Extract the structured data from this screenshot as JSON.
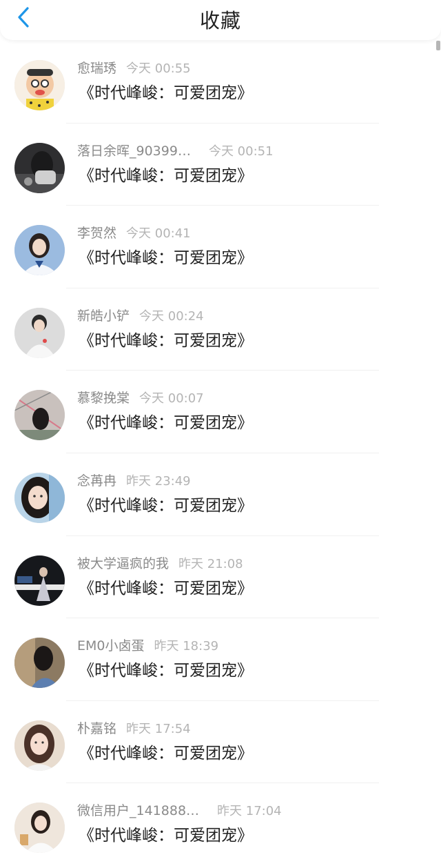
{
  "header": {
    "title": "收藏",
    "back_icon": "chevron-left-icon",
    "accent": "#1e96e8"
  },
  "items": [
    {
      "name": "愈瑞琇",
      "time": "今天 00:55",
      "content": "《时代峰峻：可爱团宠》"
    },
    {
      "name": "落日余晖_90399…",
      "time": "今天 00:51",
      "content": "《时代峰峻：可爱团宠》"
    },
    {
      "name": "李贺然",
      "time": "今天 00:41",
      "content": "《时代峰峻：可爱团宠》"
    },
    {
      "name": "新皓小铲",
      "time": "今天 00:24",
      "content": "《时代峰峻：可爱团宠》"
    },
    {
      "name": "慕黎挽棠",
      "time": "今天 00:07",
      "content": "《时代峰峻：可爱团宠》"
    },
    {
      "name": "念苒冉",
      "time": "昨天 23:49",
      "content": "《时代峰峻：可爱团宠》"
    },
    {
      "name": "被大学逼疯的我",
      "time": "昨天 21:08",
      "content": "《时代峰峻：可爱团宠》"
    },
    {
      "name": "EM0小卤蛋",
      "time": "昨天 18:39",
      "content": "《时代峰峻：可爱团宠》"
    },
    {
      "name": "朴嘉铭",
      "time": "昨天 17:54",
      "content": "《时代峰峻：可爱团宠》"
    },
    {
      "name": "微信用户_141888…",
      "time": "昨天 17:04",
      "content": "《时代峰峻：可爱团宠》"
    }
  ]
}
